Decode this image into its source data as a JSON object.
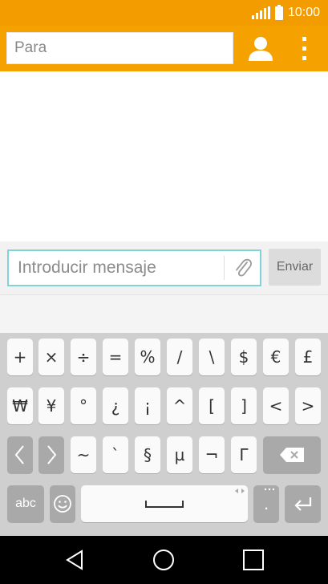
{
  "status_bar": {
    "time": "10:00",
    "signal_icon": "signal-bars-icon",
    "battery_icon": "battery-icon"
  },
  "header": {
    "to_placeholder": "Para",
    "contact_icon": "person-icon",
    "menu_icon": "overflow-menu-icon"
  },
  "compose": {
    "message_placeholder": "Introducir mensaje",
    "attach_icon": "paperclip-icon",
    "send_label": "Enviar"
  },
  "keyboard": {
    "row1": [
      "+",
      "×",
      "÷",
      "=",
      "%",
      "/",
      "\\",
      "$",
      "€",
      "£"
    ],
    "row2": [
      "₩",
      "¥",
      "°",
      "¿",
      "¡",
      "^",
      "[",
      "]",
      "<",
      ">"
    ],
    "row3": [
      "~",
      "`",
      "§",
      "µ",
      "¬",
      "Γ"
    ],
    "abc_label": "abc",
    "period_label": ".",
    "colors": {
      "key": "#fafafa",
      "dark_key": "#a9a9a9",
      "background": "#cfcfcf"
    }
  },
  "colors": {
    "status_bar": "#f39c00",
    "app_bar": "#f5a100",
    "input_focus": "#7fd4da"
  },
  "nav": {
    "back_icon": "back-triangle-icon",
    "home_icon": "home-circle-icon",
    "recents_icon": "recents-square-icon"
  }
}
